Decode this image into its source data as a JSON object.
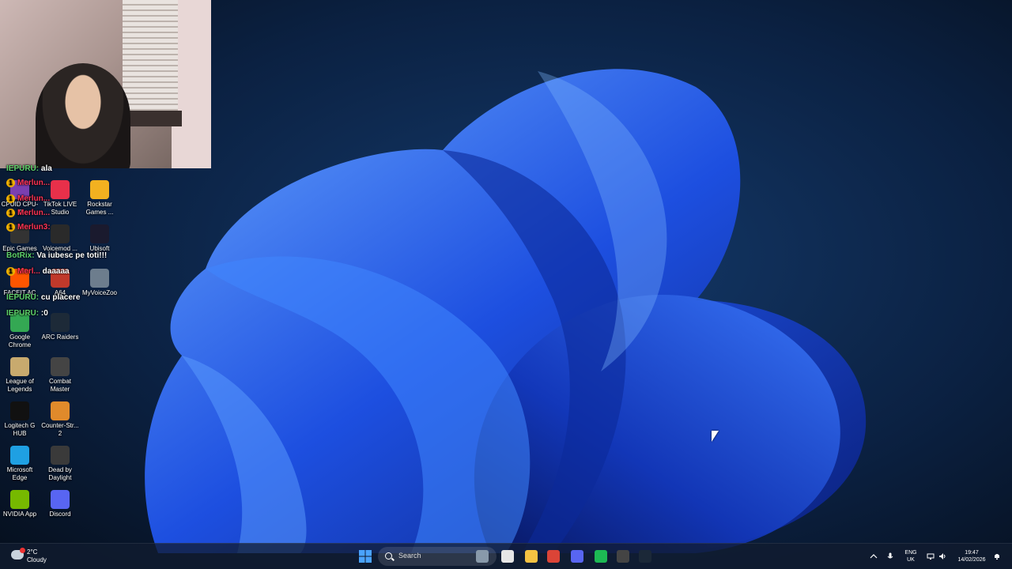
{
  "webcam": {
    "label": "streamer webcam"
  },
  "chat": [
    {
      "user": "IEPURU:",
      "msg": "ala",
      "color": "green",
      "badge": false
    },
    {
      "user": "Merlun...",
      "msg": "",
      "color": "red",
      "badge": true
    },
    {
      "user": "Merlun...",
      "msg": "",
      "color": "red",
      "badge": true
    },
    {
      "user": "Merlun...",
      "msg": "",
      "color": "red",
      "badge": true
    },
    {
      "user": "Merlun3:",
      "msg": "",
      "color": "red",
      "badge": true
    },
    {
      "user": "BotRix:",
      "msg": "Va iubesc pe toti!!!",
      "color": "green",
      "badge": false
    },
    {
      "user": "Merl...",
      "msg": "daaaaa",
      "color": "red",
      "badge": true
    },
    {
      "user": "IEPURU:",
      "msg": "cu placere",
      "color": "green",
      "badge": false
    },
    {
      "user": "IEPURU:",
      "msg": ":0",
      "color": "green",
      "badge": false
    }
  ],
  "desktop_icons": [
    {
      "label": "CPUID CPU-Z",
      "icon": "cpuz-icon",
      "color": "#7a3fb0"
    },
    {
      "label": "TikTok LIVE Studio",
      "icon": "tiktok-icon",
      "color": "#e8304a"
    },
    {
      "label": "Rockstar Games ...",
      "icon": "rockstar-icon",
      "color": "#f2b120"
    },
    {
      "label": "Epic Games",
      "icon": "epic-icon",
      "color": "#333333"
    },
    {
      "label": "Voicemod ...",
      "icon": "voicemod-icon",
      "color": "#2a2a2a"
    },
    {
      "label": "Ubisoft",
      "icon": "ubisoft-icon",
      "color": "#1a1a2e"
    },
    {
      "label": "FACEIT AC",
      "icon": "faceit-icon",
      "color": "#ff5500"
    },
    {
      "label": "A64",
      "icon": "a64-icon",
      "color": "#c0392b"
    },
    {
      "label": "MyVoiceZoo",
      "icon": "myvoicezoo-icon",
      "color": "#6d7d8d"
    },
    {
      "label": "Google Chrome",
      "icon": "chrome-icon",
      "color": "#34a853"
    },
    {
      "label": "ARC Raiders",
      "icon": "arc-raiders-icon",
      "color": "#1d2a38"
    },
    {
      "label": "League of Legends",
      "icon": "league-icon",
      "color": "#c8aa6e"
    },
    {
      "label": "Combat Master",
      "icon": "combat-master-icon",
      "color": "#444444"
    },
    {
      "label": "Logitech G HUB",
      "icon": "logitech-icon",
      "color": "#111111"
    },
    {
      "label": "Counter-Str... 2",
      "icon": "cs2-icon",
      "color": "#e08a2b"
    },
    {
      "label": "Microsoft Edge",
      "icon": "edge-icon",
      "color": "#1fa0e3"
    },
    {
      "label": "Dead by Daylight",
      "icon": "dbd-icon",
      "color": "#3a3a3a"
    },
    {
      "label": "NVIDIA App",
      "icon": "nvidia-icon",
      "color": "#76b900"
    },
    {
      "label": "Discord",
      "icon": "discord-icon",
      "color": "#5865f2"
    }
  ],
  "taskbar": {
    "weather_temp": "2°C",
    "weather_desc": "Cloudy",
    "search_placeholder": "Search",
    "apps": [
      {
        "name": "start-button",
        "color": "#4aa3ff"
      },
      {
        "name": "widgets-icon",
        "color": "#8899aa"
      },
      {
        "name": "task-view-icon",
        "color": "#e6e6e6"
      },
      {
        "name": "file-explorer-icon",
        "color": "#f5c242"
      },
      {
        "name": "chrome-taskbar-icon",
        "color": "#db4437"
      },
      {
        "name": "discord-taskbar-icon",
        "color": "#5865f2"
      },
      {
        "name": "spotify-icon",
        "color": "#1db954"
      },
      {
        "name": "obs-icon",
        "color": "#444444"
      },
      {
        "name": "steam-icon",
        "color": "#1b2838"
      }
    ],
    "lang_line1": "ENG",
    "lang_line2": "UK",
    "time": "19:47",
    "date": "14/02/2026"
  }
}
